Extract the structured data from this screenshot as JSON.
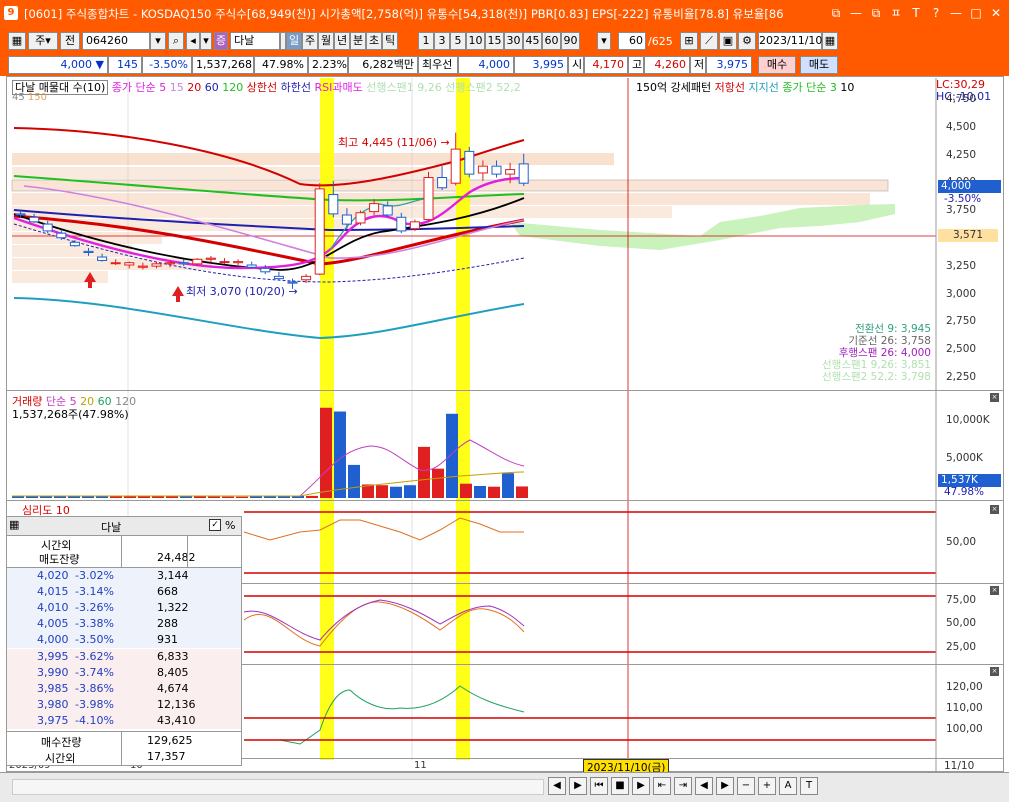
{
  "window": {
    "app_number": "9",
    "title": "[0601] 주식종합차트 - KOSDAQ150 주식수[68,949(천)] 시가총액[2,758(억)] 유통수[54,318(천)] PBR[0.83] EPS[-222] 유통비율[78.8] 유보율[86",
    "buttons": [
      "⧉",
      "—",
      "⧉",
      "ㅍ",
      "T",
      "?",
      "—",
      "□",
      "✕"
    ]
  },
  "toolbar": {
    "mode_main": "주",
    "mode_all": "전",
    "code": "064260",
    "stock_name": "다날",
    "periods": [
      "일",
      "주",
      "월",
      "년",
      "분",
      "초",
      "틱"
    ],
    "active_period": "일",
    "intervals": [
      "1",
      "3",
      "5",
      "10",
      "15",
      "30",
      "45",
      "60",
      "90"
    ],
    "count": "60",
    "count_total": "/625",
    "date": "2023/11/10"
  },
  "quote": {
    "price": "4,000",
    "arrow": "▼",
    "change": "145",
    "change_pct": "-3.50%",
    "volume": "1,537,268",
    "vol_ratio": "47.98%",
    "turnover": "2.23%",
    "amount": "6,282백만",
    "pref_label": "최우선",
    "ask": "4,000",
    "bid": "3,995",
    "open_label": "시",
    "open": "4,170",
    "high_label": "고",
    "high": "4,260",
    "low_label": "저",
    "low": "3,975",
    "buy_label": "매수",
    "sell_label": "매도"
  },
  "price_panel": {
    "legend": {
      "name": "다날 매물대 수(10)",
      "ma_label": "종가 단순",
      "ma_periods": [
        "5",
        "15",
        "20",
        "60",
        "120"
      ],
      "ma_extra": [
        "45",
        "150"
      ],
      "env_up": "상한선",
      "env_down": "하한선",
      "rsi_sell": "RSI과매도",
      "lead1": "선행스팬1 9,26",
      "lead2": "선행스팬2 52,2",
      "strong": "150억 강세패턴",
      "resistance": "저항선",
      "support": "지지선",
      "ma3": "종가 단순 3",
      "ma3_b": "10"
    },
    "lc": "LC:30,29",
    "hc": "HC:-10,01",
    "high_note": "최고 4,445 (11/06)",
    "low_note": "최저 3,070 (10/20)",
    "current_price": "4,000",
    "current_pct": "-3.50%",
    "cross_value": "3,571",
    "ichimoku": [
      "전환선 9: 3,945",
      "기준선 26: 3,758",
      "후행스팬 26: 4,000",
      "선행스팬1 9,26: 3,851",
      "선행스팬2 52,2: 3,798"
    ],
    "y_labels": [
      "4,750",
      "4,500",
      "4,250",
      "4,000",
      "3,750",
      "3,500",
      "3,250",
      "3,000",
      "2,750",
      "2,500",
      "2,250"
    ]
  },
  "chart_data": {
    "type": "candlestick",
    "x_ticks": [
      "2023/09",
      "10",
      "11"
    ],
    "candles": [
      {
        "o": 3730,
        "h": 3760,
        "l": 3700,
        "c": 3720
      },
      {
        "o": 3700,
        "h": 3730,
        "l": 3650,
        "c": 3660
      },
      {
        "o": 3640,
        "h": 3670,
        "l": 3560,
        "c": 3580
      },
      {
        "o": 3560,
        "h": 3590,
        "l": 3500,
        "c": 3520
      },
      {
        "o": 3480,
        "h": 3500,
        "l": 3440,
        "c": 3450
      },
      {
        "o": 3400,
        "h": 3430,
        "l": 3360,
        "c": 3390
      },
      {
        "o": 3350,
        "h": 3380,
        "l": 3310,
        "c": 3320
      },
      {
        "o": 3300,
        "h": 3330,
        "l": 3280,
        "c": 3300
      },
      {
        "o": 3280,
        "h": 3310,
        "l": 3250,
        "c": 3300
      },
      {
        "o": 3260,
        "h": 3300,
        "l": 3240,
        "c": 3270
      },
      {
        "o": 3270,
        "h": 3310,
        "l": 3250,
        "c": 3290
      },
      {
        "o": 3290,
        "h": 3320,
        "l": 3260,
        "c": 3300
      },
      {
        "o": 3300,
        "h": 3330,
        "l": 3270,
        "c": 3290
      },
      {
        "o": 3290,
        "h": 3340,
        "l": 3270,
        "c": 3330
      },
      {
        "o": 3330,
        "h": 3360,
        "l": 3300,
        "c": 3340
      },
      {
        "o": 3310,
        "h": 3340,
        "l": 3290,
        "c": 3310
      },
      {
        "o": 3300,
        "h": 3330,
        "l": 3280,
        "c": 3310
      },
      {
        "o": 3280,
        "h": 3310,
        "l": 3250,
        "c": 3260
      },
      {
        "o": 3250,
        "h": 3280,
        "l": 3200,
        "c": 3220
      },
      {
        "o": 3180,
        "h": 3220,
        "l": 3150,
        "c": 3160
      },
      {
        "o": 3130,
        "h": 3160,
        "l": 3070,
        "c": 3120
      },
      {
        "o": 3150,
        "h": 3200,
        "l": 3120,
        "c": 3180
      },
      {
        "o": 3200,
        "h": 4000,
        "l": 3190,
        "c": 3950
      },
      {
        "o": 3900,
        "h": 4020,
        "l": 3700,
        "c": 3730
      },
      {
        "o": 3720,
        "h": 3780,
        "l": 3600,
        "c": 3640
      },
      {
        "o": 3650,
        "h": 3760,
        "l": 3630,
        "c": 3740
      },
      {
        "o": 3750,
        "h": 3860,
        "l": 3720,
        "c": 3820
      },
      {
        "o": 3800,
        "h": 3840,
        "l": 3700,
        "c": 3720
      },
      {
        "o": 3700,
        "h": 3740,
        "l": 3560,
        "c": 3580
      },
      {
        "o": 3600,
        "h": 3680,
        "l": 3580,
        "c": 3660
      },
      {
        "o": 3680,
        "h": 4100,
        "l": 3660,
        "c": 4050
      },
      {
        "o": 4050,
        "h": 4150,
        "l": 3940,
        "c": 3960
      },
      {
        "o": 4000,
        "h": 4445,
        "l": 3980,
        "c": 4300
      },
      {
        "o": 4280,
        "h": 4320,
        "l": 4050,
        "c": 4080
      },
      {
        "o": 4090,
        "h": 4200,
        "l": 4020,
        "c": 4150
      },
      {
        "o": 4150,
        "h": 4200,
        "l": 4050,
        "c": 4080
      },
      {
        "o": 4080,
        "h": 4180,
        "l": 4000,
        "c": 4120
      },
      {
        "o": 4170,
        "h": 4260,
        "l": 3975,
        "c": 4000
      }
    ],
    "volume_label": "거래량",
    "volume_ma_label": "단순",
    "volume_ma_periods": [
      "5",
      "20",
      "60",
      "120"
    ],
    "volume_text": "1,537,268주(47.98%)",
    "volume_y_labels": [
      "10,000K",
      "5,000K"
    ],
    "volume_current": "1,537K",
    "volume_current_pct": "47.98%",
    "volumes": [
      300,
      280,
      250,
      240,
      260,
      230,
      220,
      210,
      200,
      240,
      230,
      220,
      210,
      200,
      190,
      180,
      170,
      200,
      210,
      260,
      300,
      280,
      12000,
      11500,
      4400,
      1800,
      1700,
      1500,
      1700,
      6800,
      3900,
      11200,
      1900,
      1600,
      1500,
      3300,
      1537
    ],
    "psych_label": "심리도 10",
    "osc_y_labels": [
      "50,00",
      "75,00",
      "50,00",
      "25,00",
      "120,00",
      "110,00",
      "100,00"
    ]
  },
  "orderbook": {
    "title": "다날",
    "toggle": "%",
    "head_label1": "시간외",
    "head_label2": "매도잔량",
    "head_value": "24,482",
    "asks": [
      {
        "price": "4,020",
        "pct": "-3.02%",
        "qty": "3,144"
      },
      {
        "price": "4,015",
        "pct": "-3.14%",
        "qty": "668"
      },
      {
        "price": "4,010",
        "pct": "-3.26%",
        "qty": "1,322"
      },
      {
        "price": "4,005",
        "pct": "-3.38%",
        "qty": "288"
      },
      {
        "price": "4,000",
        "pct": "-3.50%",
        "qty": "931"
      }
    ],
    "bids": [
      {
        "price": "3,995",
        "pct": "-3.62%",
        "qty": "6,833"
      },
      {
        "price": "3,990",
        "pct": "-3.74%",
        "qty": "8,405"
      },
      {
        "price": "3,985",
        "pct": "-3.86%",
        "qty": "4,674"
      },
      {
        "price": "3,980",
        "pct": "-3.98%",
        "qty": "12,136"
      },
      {
        "price": "3,975",
        "pct": "-4.10%",
        "qty": "43,410"
      }
    ],
    "bid_total_label": "매수잔량",
    "bid_total": "129,625",
    "after_label": "시간외",
    "after_value": "17,357"
  },
  "bottom": {
    "date_cursor": "2023/11/10(금)",
    "right_date": "11/10",
    "nav_buttons": [
      "◀",
      "▶",
      "⏮",
      "■",
      "▶",
      "⇤",
      "⇥",
      "◀",
      "▶",
      "−",
      "+",
      "A",
      "T"
    ]
  },
  "colors": {
    "accent": "#ff5a00",
    "up": "#e02020",
    "down": "#1f5fcf",
    "highlight": "#ffff00"
  }
}
